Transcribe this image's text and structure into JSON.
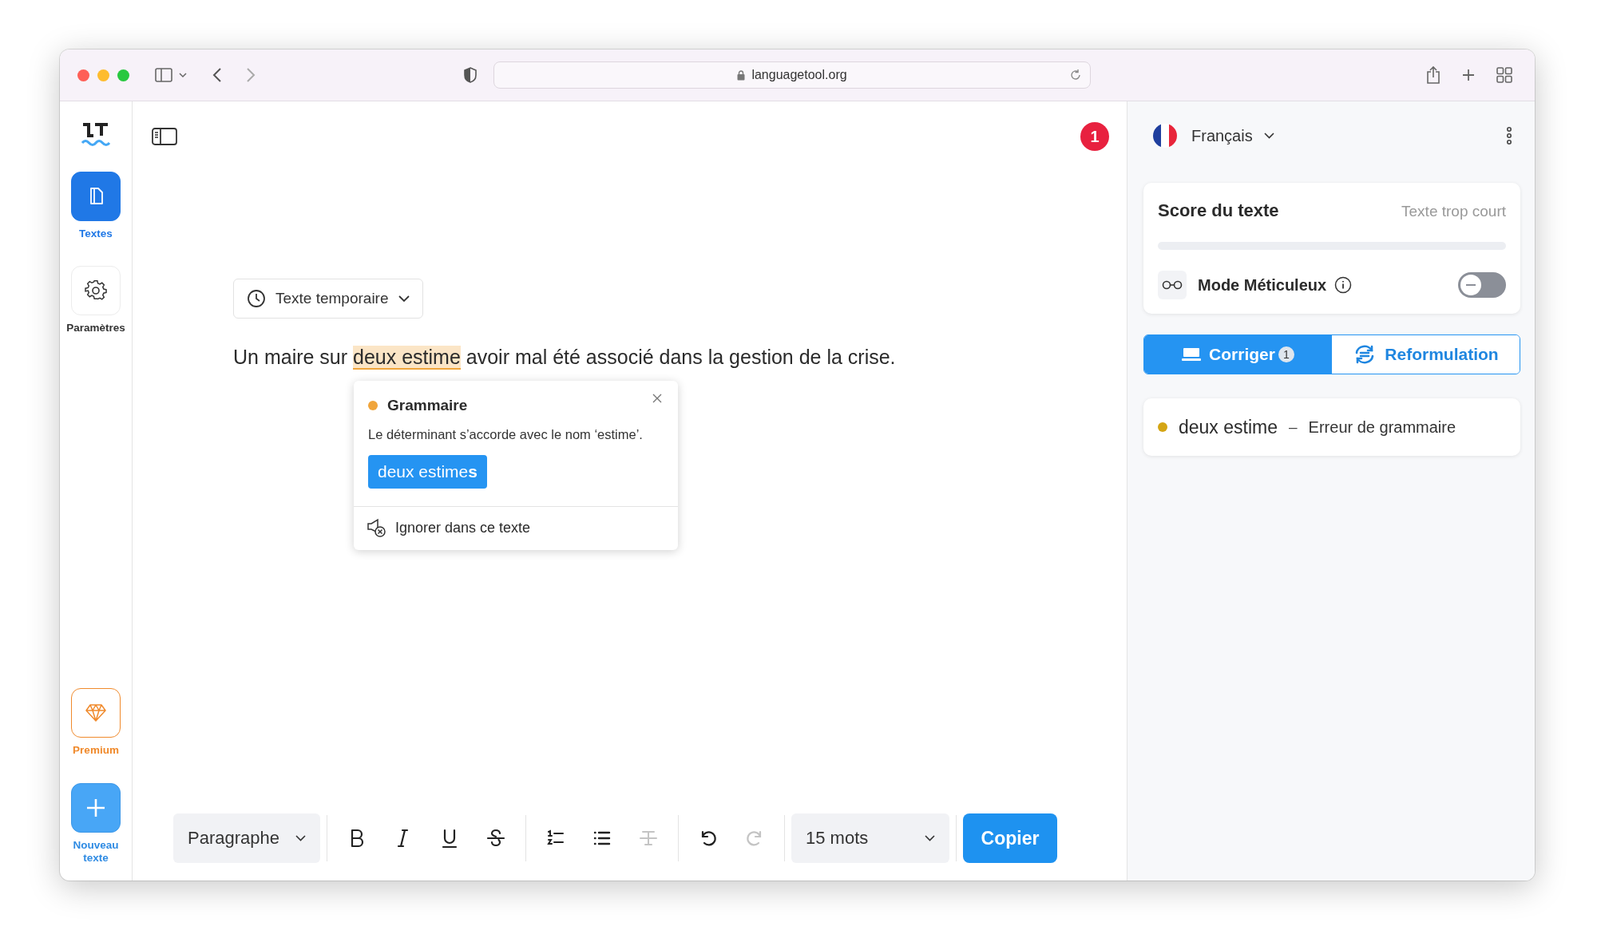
{
  "browser": {
    "url": "languagetool.org"
  },
  "sidebar": {
    "items": [
      {
        "kind": "texts",
        "label": "Textes",
        "selected": true
      },
      {
        "kind": "settings",
        "label": "Paramètres",
        "selected": false
      }
    ],
    "bottom": [
      {
        "kind": "premium",
        "label": "Premium"
      },
      {
        "kind": "new",
        "label": "Nouveau texte"
      }
    ]
  },
  "editor": {
    "notification_count": "1",
    "document_menu": "Texte temporaire",
    "text_before": "Un maire sur",
    "flagged_text": "deux estime",
    "text_after": "avoir mal été associé dans la gestion de la crise.",
    "popup": {
      "category": "Grammaire",
      "color": "#f0a53c",
      "message": "Le déterminant s’accorde avec le nom ‘estime’.",
      "suggestion": "deux estime**s**",
      "ignore": "Ignorer dans ce texte"
    }
  },
  "toolbar": {
    "block_style": "Paragraphe",
    "tools": [
      {
        "kind": "bold",
        "disabled": false
      },
      {
        "kind": "italic",
        "disabled": false
      },
      {
        "kind": "underline",
        "disabled": false
      },
      {
        "kind": "strike",
        "disabled": false
      },
      {
        "kind": "sep"
      },
      {
        "kind": "ordered",
        "disabled": false
      },
      {
        "kind": "bullets",
        "disabled": false
      },
      {
        "kind": "clear",
        "disabled": true
      },
      {
        "kind": "sep"
      },
      {
        "kind": "undo",
        "disabled": false
      },
      {
        "kind": "redo",
        "disabled": true
      }
    ],
    "word_count": "15 mots",
    "copy": "Copier"
  },
  "panel": {
    "language": "Français",
    "score": {
      "title": "Score du texte",
      "status": "Texte trop court"
    },
    "picky_mode": {
      "label": "Mode Méticuleux",
      "on": false
    },
    "tabs": [
      {
        "kind": "correct",
        "label": "Corriger",
        "badge": "1",
        "selected": true
      },
      {
        "kind": "rephrase",
        "label": "Reformulation",
        "selected": false
      }
    ],
    "issues": [
      {
        "word": "deux estime",
        "separator": "–",
        "type": "Erreur de grammaire",
        "color": "#d4a514"
      }
    ]
  }
}
